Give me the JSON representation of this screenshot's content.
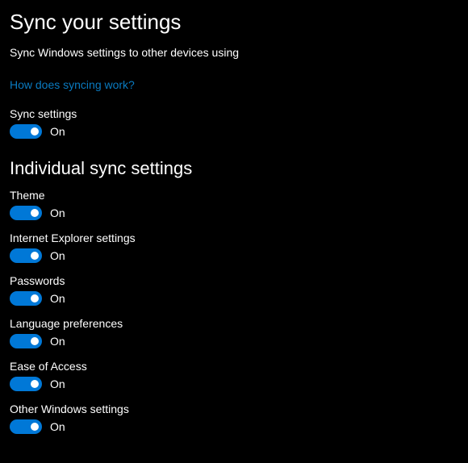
{
  "header": {
    "title": "Sync your settings",
    "description": "Sync Windows settings to other devices using",
    "help_link": "How does syncing work?"
  },
  "main_toggle": {
    "label": "Sync settings",
    "state": "On"
  },
  "section": {
    "title": "Individual sync settings"
  },
  "individual": [
    {
      "label": "Theme",
      "state": "On"
    },
    {
      "label": "Internet Explorer settings",
      "state": "On"
    },
    {
      "label": "Passwords",
      "state": "On"
    },
    {
      "label": "Language preferences",
      "state": "On"
    },
    {
      "label": "Ease of Access",
      "state": "On"
    },
    {
      "label": "Other Windows settings",
      "state": "On"
    }
  ]
}
